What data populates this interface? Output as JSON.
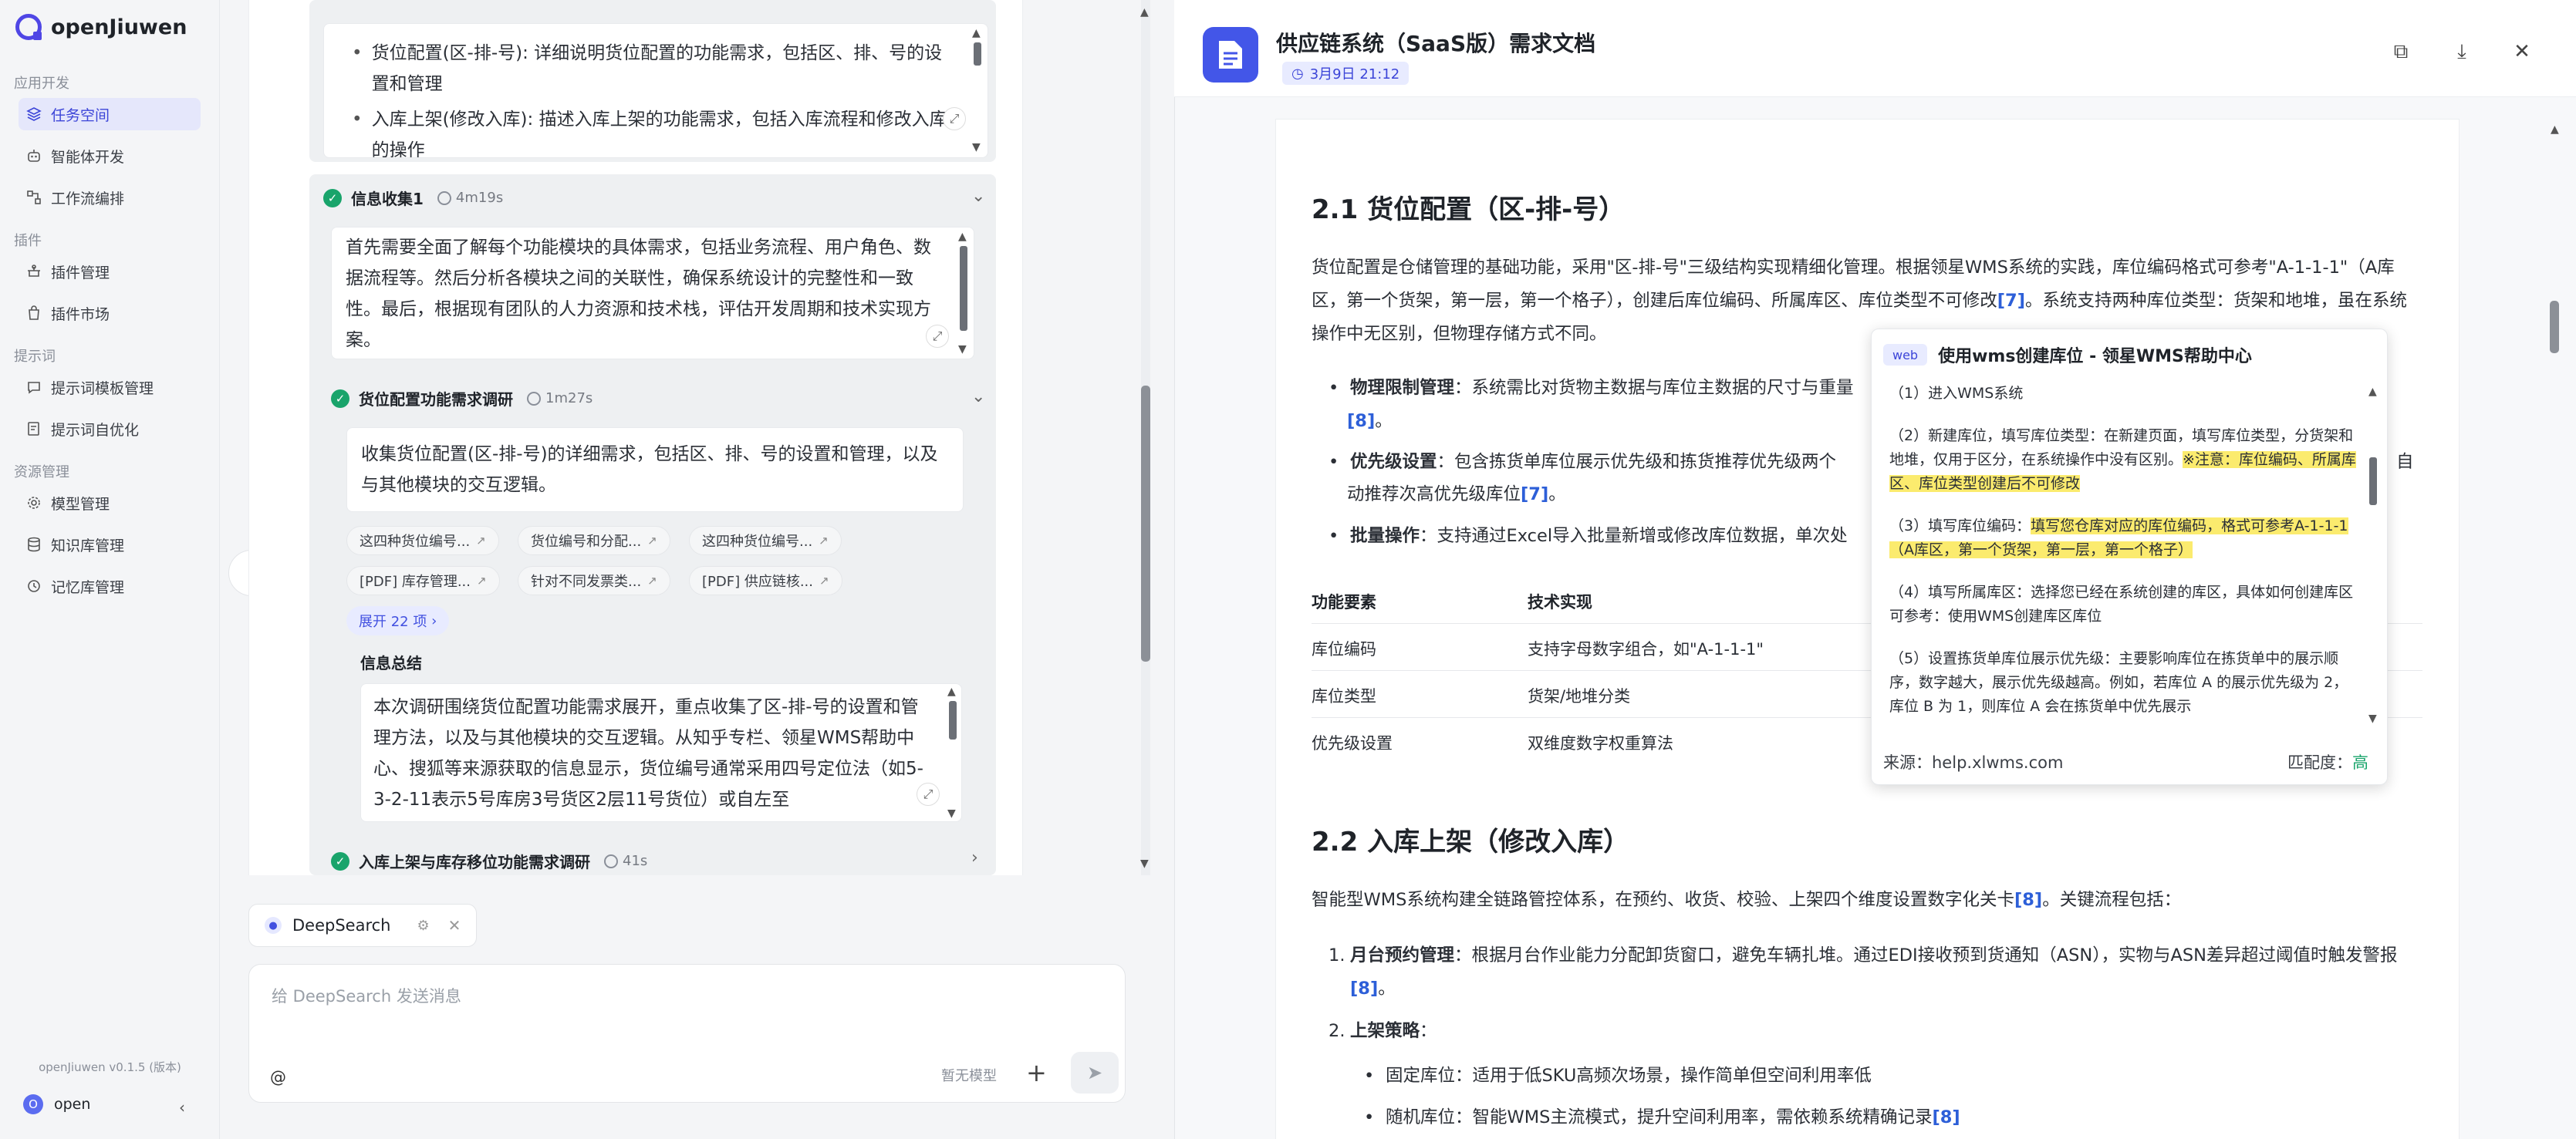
{
  "app": {
    "brand": "openJiuwen",
    "version": "openJiuwen v0.1.5 (版本)",
    "user": "open",
    "user_initial": "O"
  },
  "sidebar": {
    "sections": [
      {
        "label": "应用开发",
        "items": [
          "任务空间",
          "智能体开发",
          "工作流编排"
        ]
      },
      {
        "label": "插件",
        "items": [
          "插件管理",
          "插件市场"
        ]
      },
      {
        "label": "提示词",
        "items": [
          "提示词模板管理",
          "提示词自优化"
        ]
      },
      {
        "label": "资源管理",
        "items": [
          "模型管理",
          "知识库管理",
          "记忆库管理"
        ]
      }
    ]
  },
  "trace": {
    "top_card": {
      "items": [
        "货位配置(区-排-号): 详细说明货位配置的功能需求，包括区、排、号的设置和管理",
        "入库上架(修改入库): 描述入库上架的功能需求，包括入库流程和修改入库的操作"
      ]
    },
    "info1": {
      "title": "信息收集1",
      "time": "4m19s",
      "text": "首先需要全面了解每个功能模块的具体需求，包括业务流程、用户角色、数据流程等。然后分析各模块之间的关联性，确保系统设计的完整性和一致性。最后，根据现有团队的人力资源和技术栈，评估开发周期和技术实现方案。"
    },
    "research": {
      "title": "货位配置功能需求调研",
      "time": "1m27s",
      "query": "收集货位配置(区-排-号)的详细需求，包括区、排、号的设置和管理，以及与其他模块的交互逻辑。",
      "chips": [
        "这四种货位编号...",
        "货位编号和分配...",
        "这四种货位编号...",
        "[PDF] 库存管理...",
        "针对不同发票类...",
        "[PDF] 供应链核..."
      ],
      "expand": "展开 22 项",
      "summary_title": "信息总结",
      "summary": "本次调研围绕货位配置功能需求展开，重点收集了区-排-号的设置和管理方法，以及与其他模块的交互逻辑。从知乎专栏、领星WMS帮助中心、搜狐等来源获取的信息显示，货位编号通常采用四号定位法（如5-3-2-11表示5号库房3号货区2层11号货位）或自左至"
    },
    "next": {
      "title": "入库上架与库存移位功能需求调研",
      "time": "41s"
    }
  },
  "input": {
    "tag": "DeepSearch",
    "placeholder": "给 DeepSearch 发送消息",
    "model": "暂无模型",
    "at": "@"
  },
  "doc": {
    "title": "供应链系统（SaaS版）需求文档",
    "date": "3月9日 21:12",
    "h_21": "2.1 货位配置（区-排-号）",
    "p1_a": "货位配置是仓储管理的基础功能，采用\"区-排-号\"三级结构实现精细化管理。根据领星WMS系统的实践，库位编码格式可参考\"A-1-1-1\"（A库区，第一个货架，第一层，第一个格子），创建后库位编码、所属库区、库位类型不可修改",
    "cite7": "[7]",
    "p1_b": "。系统支持两种库位类型：货架和地堆，虽在系统操作中无区别，但物理存储方式不同。",
    "b1_t": "物理限制管理",
    "b1": "：系统需比对货物主数据与库位主数据的尺寸与重量",
    "cite8": "[8]",
    "b1_end": "。",
    "b2_t": "优先级设置",
    "b2": "：包含拣货单库位展示优先级和拣货推荐优先级两个",
    "b2_right": "自",
    "b2_l2": "动推荐次高优先级库位",
    "b3_t": "批量操作",
    "b3": "：支持通过Excel导入批量新增或修改库位数据，单次处",
    "table": {
      "headers": [
        "功能要素",
        "技术实现"
      ],
      "rows": [
        [
          "库位编码",
          "支持字母数字组合，如\"A-1-1-1\""
        ],
        [
          "库位类型",
          "货架/地堆分类"
        ],
        [
          "优先级设置",
          "双维度数字权重算法"
        ]
      ]
    },
    "h_22": "2.2 入库上架（修改入库）",
    "p2_a": "智能型WMS系统构建全链路管控体系，在预约、收货、校验、上架四个维度设置数字化关卡",
    "p2_b": "。关键流程包括：",
    "n1_t": "月台预约管理",
    "n1": "：根据月台作业能力分配卸货窗口，避免车辆扎堆。通过EDI接收预到货通知（ASN），实物与ASN差异超过阈值时触发警报",
    "n2_t": "上架策略",
    "s1": "固定库位：适用于低SKU高频次场景，操作简单但空间利用率低",
    "s2": "随机库位：智能WMS主流模式，提升空间利用率，需依赖系统精确记录"
  },
  "popup": {
    "tag": "web",
    "title": "使用wms创建库位 - 领星WMS帮助中心",
    "steps": [
      "（1）进入WMS系统",
      "（2）新建库位，填写库位类型：在新建页面，填写库位类型，分货架和地堆，仅用于区分，在系统操作中没有区别。",
      "※注意：库位编码、所属库区、库位类型创建后不可修改",
      "（3）填写库位编码：",
      "填写您仓库对应的库位编码，格式可参考A-1-1-1（A库区，第一个货架，第一层，第一个格子）",
      "（4）填写所属库区：选择您已经在系统创建的库区，具体如何创建库区可参考：使用WMS创建库区库位",
      "（5）设置拣货单库位展示优先级：主要影响库位在拣货单中的展示顺序，数字越大，展示优先级越高。例如，若库位 A 的展示优先级为 2，库位 B 为 1，则库位 A 会在拣货单中优先展示"
    ],
    "source_label": "来源：",
    "source": "help.xlwms.com",
    "match_label": "匹配度：",
    "match": "高"
  }
}
